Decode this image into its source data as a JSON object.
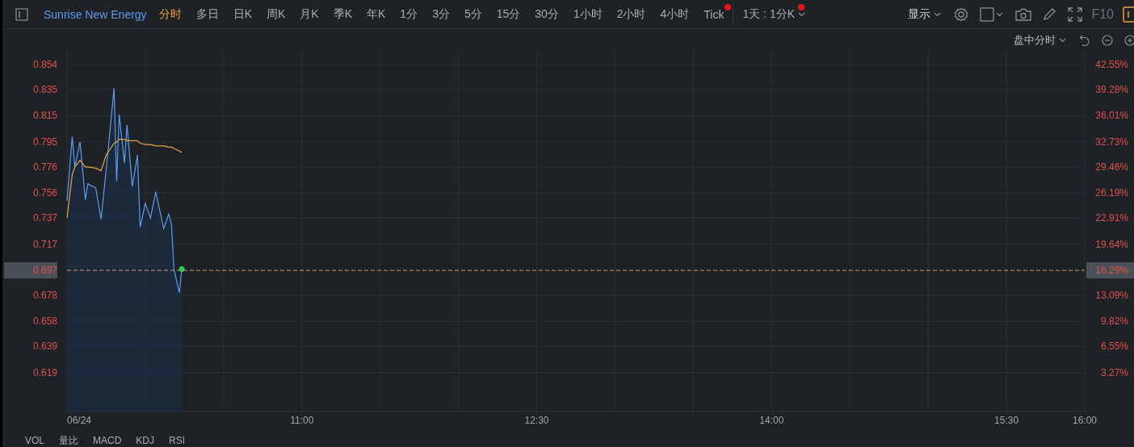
{
  "toolbar": {
    "title": "Sunrise New Energy",
    "periods": [
      {
        "label": "分时",
        "selected": true,
        "badge": false
      },
      {
        "label": "多日",
        "selected": false,
        "badge": false
      },
      {
        "label": "日K",
        "selected": false,
        "badge": false
      },
      {
        "label": "周K",
        "selected": false,
        "badge": false
      },
      {
        "label": "月K",
        "selected": false,
        "badge": false
      },
      {
        "label": "季K",
        "selected": false,
        "badge": false
      },
      {
        "label": "年K",
        "selected": false,
        "badge": false
      },
      {
        "label": "1分",
        "selected": false,
        "badge": false
      },
      {
        "label": "3分",
        "selected": false,
        "badge": false
      },
      {
        "label": "5分",
        "selected": false,
        "badge": false
      },
      {
        "label": "15分",
        "selected": false,
        "badge": false
      },
      {
        "label": "30分",
        "selected": false,
        "badge": false
      },
      {
        "label": "1小时",
        "selected": false,
        "badge": false
      },
      {
        "label": "2小时",
        "selected": false,
        "badge": false
      },
      {
        "label": "4小时",
        "selected": false,
        "badge": false
      },
      {
        "label": "Tick",
        "selected": false,
        "badge": true
      }
    ],
    "range_dropdown": {
      "label": "1天 : 1分K",
      "badge": true
    },
    "display_dropdown": "显示",
    "f10_label": "F10"
  },
  "subbar": {
    "mode_dropdown": "盘中分时"
  },
  "chart": {
    "last_price": {
      "pct_label": "16.29%"
    },
    "right_axis": [
      "42.55%",
      "39.28%",
      "36.01%",
      "32.73%",
      "29.46%",
      "26.19%",
      "22.91%",
      "19.64%",
      "13.09%",
      "9.82%",
      "6.55%",
      "3.27%"
    ],
    "chart_data": {
      "type": "line",
      "x": [
        9.5,
        9.533,
        9.55,
        9.583,
        9.617,
        9.633,
        9.683,
        9.717,
        9.75,
        9.8,
        9.817,
        9.833,
        9.867,
        9.883,
        9.917,
        9.95,
        9.967,
        10,
        10.033,
        10.067,
        10.117,
        10.15,
        10.167,
        10.183,
        10.217,
        10.233
      ],
      "series": [
        {
          "color": "#5b9cf0",
          "values": [
            0.75,
            0.799,
            0.776,
            0.795,
            0.751,
            0.763,
            0.76,
            0.736,
            0.774,
            0.836,
            0.765,
            0.816,
            0.779,
            0.808,
            0.761,
            0.785,
            0.73,
            0.748,
            0.737,
            0.757,
            0.729,
            0.74,
            0.732,
            0.698,
            0.68,
            0.698
          ]
        },
        {
          "color": "#e8a33a",
          "values": [
            0.737,
            0.77,
            0.776,
            0.781,
            0.776,
            0.776,
            0.775,
            0.773,
            0.785,
            0.794,
            0.795,
            0.797,
            0.797,
            0.796,
            0.796,
            0.796,
            0.794,
            0.793,
            0.793,
            0.792,
            0.792,
            0.791,
            0.791,
            0.79,
            0.788,
            0.787
          ]
        }
      ],
      "xlim": [
        9.5,
        16
      ],
      "grid": true,
      "ref_lines": [
        {
          "axis": "y",
          "value": 0.697,
          "label": "0.697"
        }
      ],
      "ylim": [
        0.5893,
        0.8639
      ],
      "xticks": [
        {
          "value": 9.5,
          "label": "06/24"
        },
        {
          "value": 11,
          "label": "11:00"
        },
        {
          "value": 12.5,
          "label": "12:30"
        },
        {
          "value": 14,
          "label": "14:00"
        },
        {
          "value": 15.5,
          "label": "15:30"
        },
        {
          "value": 16,
          "label": "16:00"
        }
      ],
      "yticks": [
        {
          "value": 0.854,
          "label": "0.854"
        },
        {
          "value": 0.835,
          "label": "0.835"
        },
        {
          "value": 0.815,
          "label": "0.815"
        },
        {
          "value": 0.795,
          "label": "0.795"
        },
        {
          "value": 0.776,
          "label": "0.776"
        },
        {
          "value": 0.756,
          "label": "0.756"
        },
        {
          "value": 0.737,
          "label": "0.737"
        },
        {
          "value": 0.717,
          "label": "0.717"
        },
        {
          "value": 0.678,
          "label": "0.678"
        },
        {
          "value": 0.658,
          "label": "0.658"
        },
        {
          "value": 0.639,
          "label": "0.639"
        },
        {
          "value": 0.619,
          "label": "0.619"
        }
      ]
    }
  },
  "indicators": [
    "VOL",
    "量比",
    "MACD",
    "KDJ",
    "RSI"
  ]
}
